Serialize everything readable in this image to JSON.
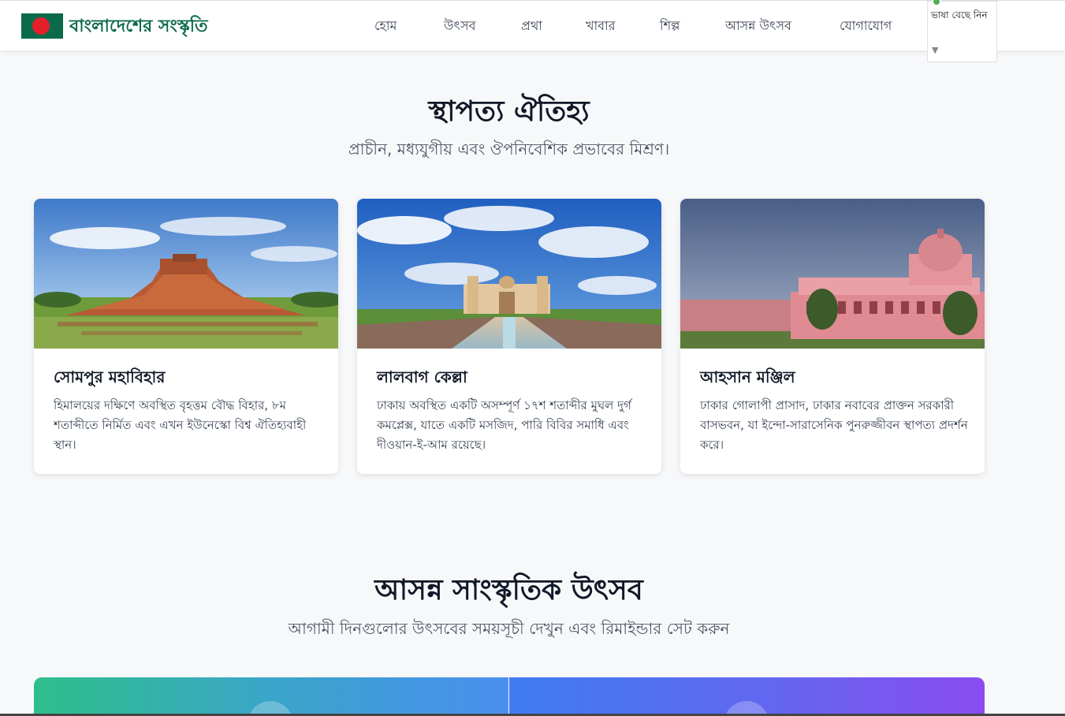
{
  "header": {
    "brand": "বাংলাদেশের সংস্কৃতি",
    "nav": [
      "হোম",
      "উৎসব",
      "প্রথা",
      "খাবার",
      "শিল্প",
      "আসন্ন উৎসব",
      "যোগাযোগ"
    ],
    "language_label": "ভাষা বেছে নিন",
    "language_caret": "▼"
  },
  "colors": {
    "brand_green": "#0b6a4a",
    "flag_red": "#e5202a"
  },
  "architecture": {
    "title": "স্থাপত্য ঐতিহ্য",
    "subtitle": "প্রাচীন, মধ্যযুগীয় এবং ঔপনিবেশিক প্রভাবের মিশ্রণ।",
    "cards": [
      {
        "title": "সোমপুর মহাবিহার",
        "text": "হিমালয়ের দক্ষিণে অবস্থিত বৃহত্তম বৌদ্ধ বিহার, ৮ম শতাব্দীতে নির্মিত এবং এখন ইউনেস্কো বিশ্ব ঐতিহ্যবাহী স্থান।",
        "image": "paharpur-ruins-photo"
      },
      {
        "title": "লালবাগ কেল্লা",
        "text": "ঢাকায় অবস্থিত একটি অসম্পূর্ণ ১৭শ শতাব্দীর মুঘল দুর্গ কমপ্লেক্স, যাতে একটি মসজিদ, পারি বিবির সমাধি এবং দীওয়ান-ই-আম রয়েছে।",
        "image": "lalbagh-fort-photo"
      },
      {
        "title": "আহসান মঞ্জিল",
        "text": "ঢাকার গোলাপী প্রাসাদ, ঢাকার নবাবের প্রাক্তন সরকারী বাসভবন, যা ইন্দো-সারাসেনিক পুনরুজ্জীবন স্থাপত্য প্রদর্শন করে।",
        "image": "ahsan-manzil-photo"
      }
    ]
  },
  "festivals": {
    "title": "আসন্ন সাংস্কৃতিক উৎসব",
    "subtitle": "আগামী দিনগুলোর উৎসবের সময়সূচী দেখুন এবং রিমাইন্ডার সেট করুন"
  }
}
